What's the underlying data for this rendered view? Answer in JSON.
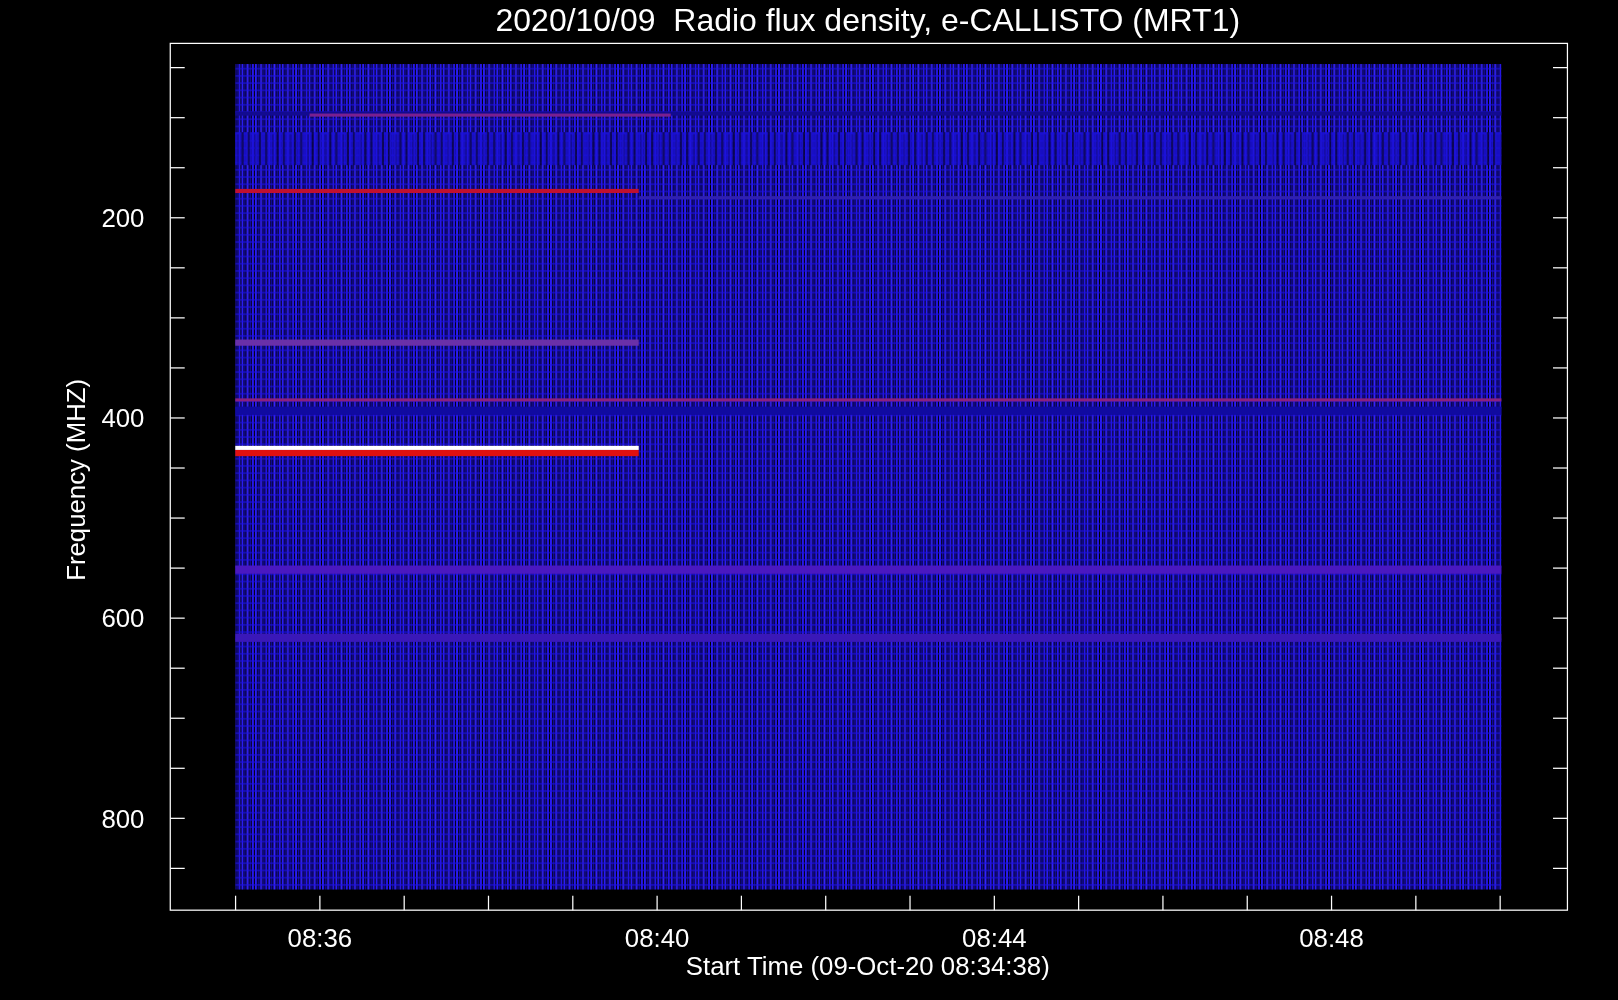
{
  "title": "2020/10/09  Radio flux density, e-CALLISTO (MRT1)",
  "ylabel": "Frequency (MHZ)",
  "xlabel": "Start Time (09-Oct-20 08:34:38)",
  "yticks": [
    "200",
    "400",
    "600",
    "800"
  ],
  "xticks": [
    "08:36",
    "08:40",
    "08:44",
    "08:48"
  ]
}
